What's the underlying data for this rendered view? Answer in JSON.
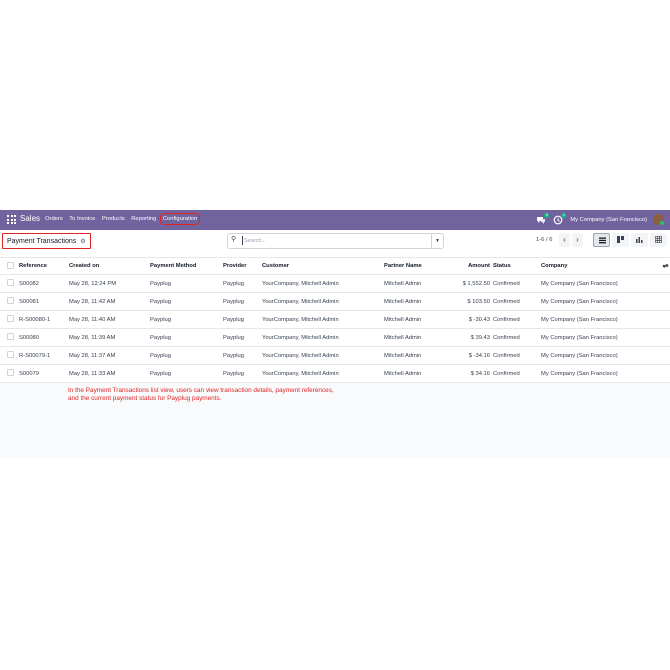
{
  "navbar": {
    "app_name": "Sales",
    "menu": [
      "Orders",
      "To Invoice",
      "Products",
      "Reporting",
      "Configuration"
    ],
    "messages_badge": "5",
    "activity_badge": "4",
    "company": "My Company (San Francisco)",
    "icons": [
      "apps-grid-icon",
      "chat-icon",
      "clock-icon",
      "avatar"
    ]
  },
  "control_panel": {
    "title": "Payment Transactions",
    "search_placeholder": "Search...",
    "pager": "1-6 / 6",
    "views": [
      "list",
      "kanban",
      "graph",
      "pivot"
    ],
    "active_view": "list"
  },
  "table": {
    "columns": [
      "Reference",
      "Created on",
      "Payment Method",
      "Provider",
      "Customer",
      "Partner Name",
      "Amount",
      "Status",
      "Company"
    ],
    "rows": [
      [
        "S00082",
        "May 28, 12:24 PM",
        "Payplug",
        "Payplug",
        "YourCompany, Mitchell Admin",
        "Mitchell Admin",
        "$ 1,552.50",
        "Confirmed",
        "My Company (San Francisco)"
      ],
      [
        "S00081",
        "May 28, 11:42 AM",
        "Payplug",
        "Payplug",
        "YourCompany, Mitchell Admin",
        "Mitchell Admin",
        "$ 103.50",
        "Confirmed",
        "My Company (San Francisco)"
      ],
      [
        "R-S00080-1",
        "May 28, 11:40 AM",
        "Payplug",
        "Payplug",
        "YourCompany, Mitchell Admin",
        "Mitchell Admin",
        "$ -30.43",
        "Confirmed",
        "My Company (San Francisco)"
      ],
      [
        "S00080",
        "May 28, 11:39 AM",
        "Payplug",
        "Payplug",
        "YourCompany, Mitchell Admin",
        "Mitchell Admin",
        "$ 39.43",
        "Confirmed",
        "My Company (San Francisco)"
      ],
      [
        "R-S00079-1",
        "May 28, 11:37 AM",
        "Payplug",
        "Payplug",
        "YourCompany, Mitchell Admin",
        "Mitchell Admin",
        "$ -34.16",
        "Confirmed",
        "My Company (San Francisco)"
      ],
      [
        "S00079",
        "May 28, 11:33 AM",
        "Payplug",
        "Payplug",
        "YourCompany, Mitchell Admin",
        "Mitchell Admin",
        "$ 34.16",
        "Confirmed",
        "My Company (San Francisco)"
      ]
    ]
  },
  "annotation": {
    "line1": "In the Payment Transactions list view, users can view transaction details, payment references,",
    "line2": "and the current payment status for Payplug payments."
  },
  "colors": {
    "navbar": "#71639e",
    "highlight": "#e02424",
    "badge": "#10b981"
  }
}
